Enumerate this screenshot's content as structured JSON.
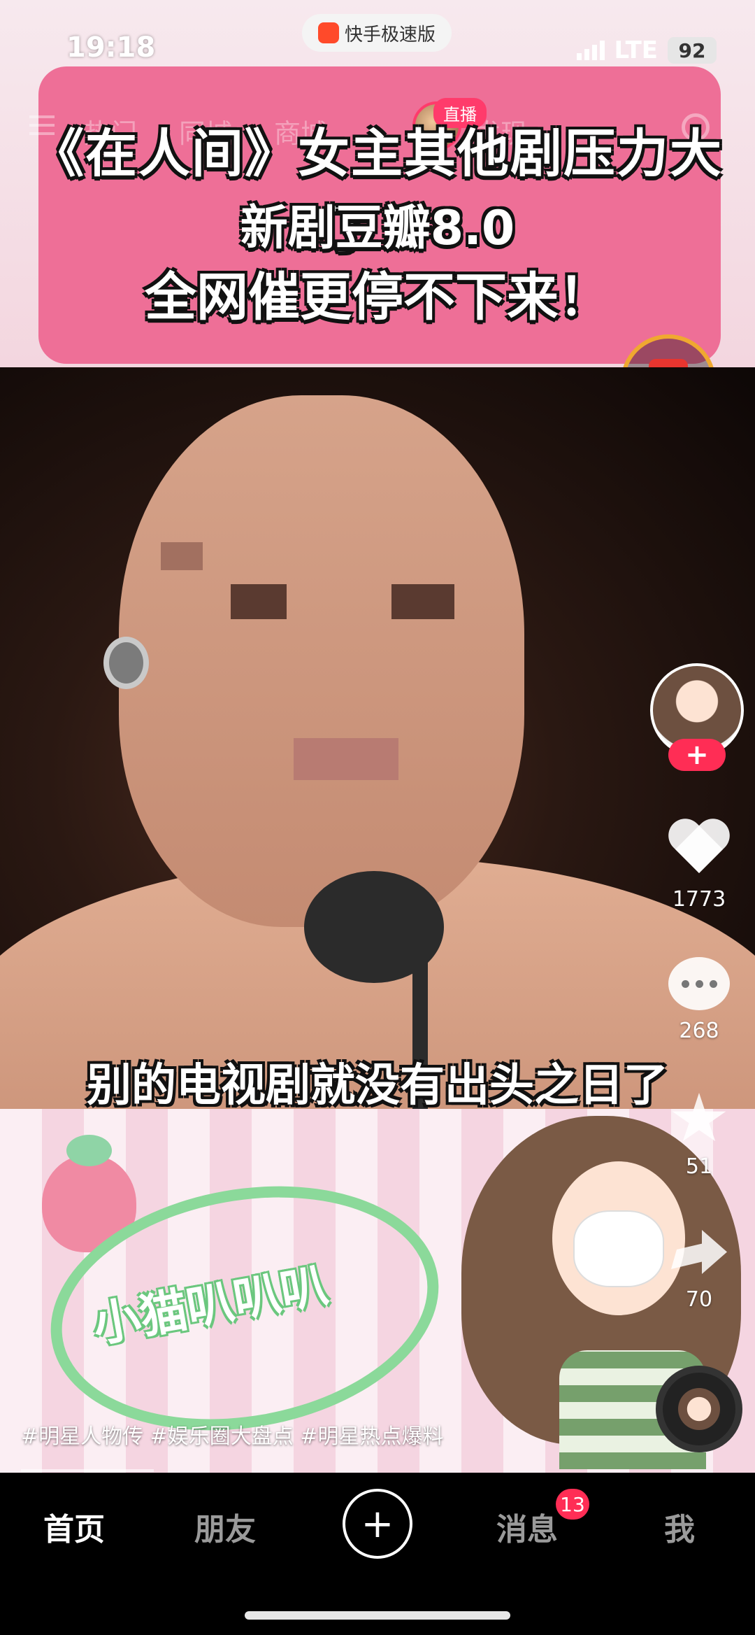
{
  "status_bar": {
    "time": "19:18",
    "app_name": "快手极速版",
    "network": "LTE",
    "battery": "92"
  },
  "top_nav": {
    "tabs": [
      "热门",
      "同城",
      "商城",
      "直播",
      "发现"
    ],
    "live_label": "直播"
  },
  "video": {
    "headline_line1": "《在人间》女主其他剧压力大了！",
    "headline_line2": "新剧豆瓣8.0",
    "headline_line3": "全网催更停不下来！",
    "subtitle": "别的电视剧就没有出头之日了",
    "sticker_text": "小猫叭叭叭",
    "hashtags": "#明星人物传 #娱乐圈大盘点 #明星热点爆料"
  },
  "actions": {
    "follow_label": "+",
    "likes": "1773",
    "comments": "268",
    "favorites": "51",
    "shares": "70"
  },
  "tab_bar": {
    "home": "首页",
    "friends": "朋友",
    "plus": "+",
    "messages": "消息",
    "messages_badge": "13",
    "me": "我"
  }
}
